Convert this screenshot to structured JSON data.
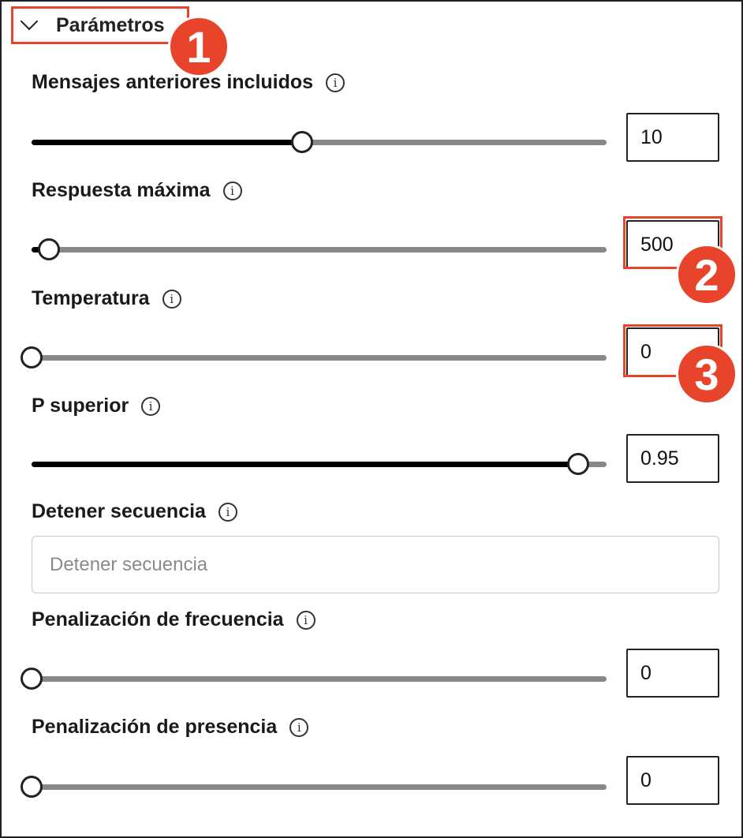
{
  "section": {
    "title": "Parámetros"
  },
  "callouts": [
    "1",
    "2",
    "3"
  ],
  "params": [
    {
      "label": "Mensajes anteriores incluidos",
      "value": "10",
      "fraction": 0.47
    },
    {
      "label": "Respuesta máxima",
      "value": "500",
      "fraction": 0.03
    },
    {
      "label": "Temperatura",
      "value": "0",
      "fraction": 0.0
    },
    {
      "label": "P superior",
      "value": "0.95",
      "fraction": 0.95
    },
    {
      "label": "Penalización de frecuencia",
      "value": "0",
      "fraction": 0.0
    },
    {
      "label": "Penalización de presencia",
      "value": "0",
      "fraction": 0.0
    }
  ],
  "stop": {
    "label": "Detener secuencia",
    "placeholder": "Detener secuencia"
  },
  "info_icon_glyph": "i",
  "colors": {
    "accent": "#e8442c",
    "fill": "#000000",
    "track": "#888888"
  }
}
